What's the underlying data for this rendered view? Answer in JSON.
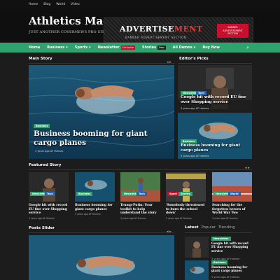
{
  "topbar": {
    "links": [
      "Home",
      "Blog",
      "World",
      "Video"
    ]
  },
  "header": {
    "logo": "Athletics Mag",
    "tagline": "JUST ANOTHER COVERNEWS PRO SITE",
    "ad": {
      "title_main": "ADVERTISE",
      "title_accent": "MENT",
      "subtitle": "BANNER ADVERTISEMENT SECTION",
      "badge": "BANNER ADVERTISEMENT SECTION"
    }
  },
  "nav": {
    "items": [
      {
        "label": "Home"
      },
      {
        "label": "Business",
        "chevron": true
      },
      {
        "label": "Sports",
        "chevron": true
      },
      {
        "label": "Newsletter",
        "tag": "Exclusive"
      },
      {
        "label": "Stories",
        "tag": "New"
      },
      {
        "label": "All Demos",
        "chevron": true
      },
      {
        "label": "Buy Now"
      }
    ],
    "accent": "#2ea36e"
  },
  "main_story": {
    "section_title": "Main Story",
    "category": "Business",
    "title": "Business booming for giant cargo planes",
    "meta": "3 years ago  AF themes"
  },
  "editors_picks": {
    "section_title": "Editor's Picks",
    "items": [
      {
        "categories": [
          "Newsletter",
          "Tech"
        ],
        "title": "Google hit with record EU fine over Shopping service",
        "meta": "3 years ago  AF themes"
      },
      {
        "categories": [
          "Business"
        ],
        "title": "Business booming for giant cargo planes",
        "meta": "3 years ago  AF themes"
      }
    ]
  },
  "featured": {
    "section_title": "Featured Story",
    "items": [
      {
        "categories": [
          "Newsletter",
          "Tech"
        ],
        "title": "Google hit with record EU fine over Shopping service",
        "meta": "3 years ago  AF themes"
      },
      {
        "categories": [
          "Business"
        ],
        "title": "Business booming for giant cargo planes",
        "meta": "3 years ago  AF themes"
      },
      {
        "categories": [
          "Newsletter",
          "Tech"
        ],
        "title": "Trump-Putin: Your toolkit to help understand the story",
        "meta": "3 years ago  AF themes"
      },
      {
        "categories": [
          "Sport",
          "Stories"
        ],
        "title": "'Somebody threatened to burn the school down'",
        "meta": "3 years ago  AF themes"
      },
      {
        "categories": [
          "Newsletter",
          "World"
        ],
        "title": "Searching for the forgotten heroes of World War Two",
        "meta": "3 years ago  AF themes"
      }
    ]
  },
  "posts_slider": {
    "section_title": "Posts Slider"
  },
  "sidebar_tabs": {
    "tabs": [
      "Latest",
      "Popular",
      "Trending"
    ],
    "items": [
      {
        "category": "Newsletter",
        "title": "Google hit with record EU fine over Shopping service",
        "meta": "3 years ago  AF themes"
      },
      {
        "category": "Business",
        "title": "Business booming for giant cargo planes",
        "meta": "3 years ago  AF themes"
      }
    ]
  }
}
